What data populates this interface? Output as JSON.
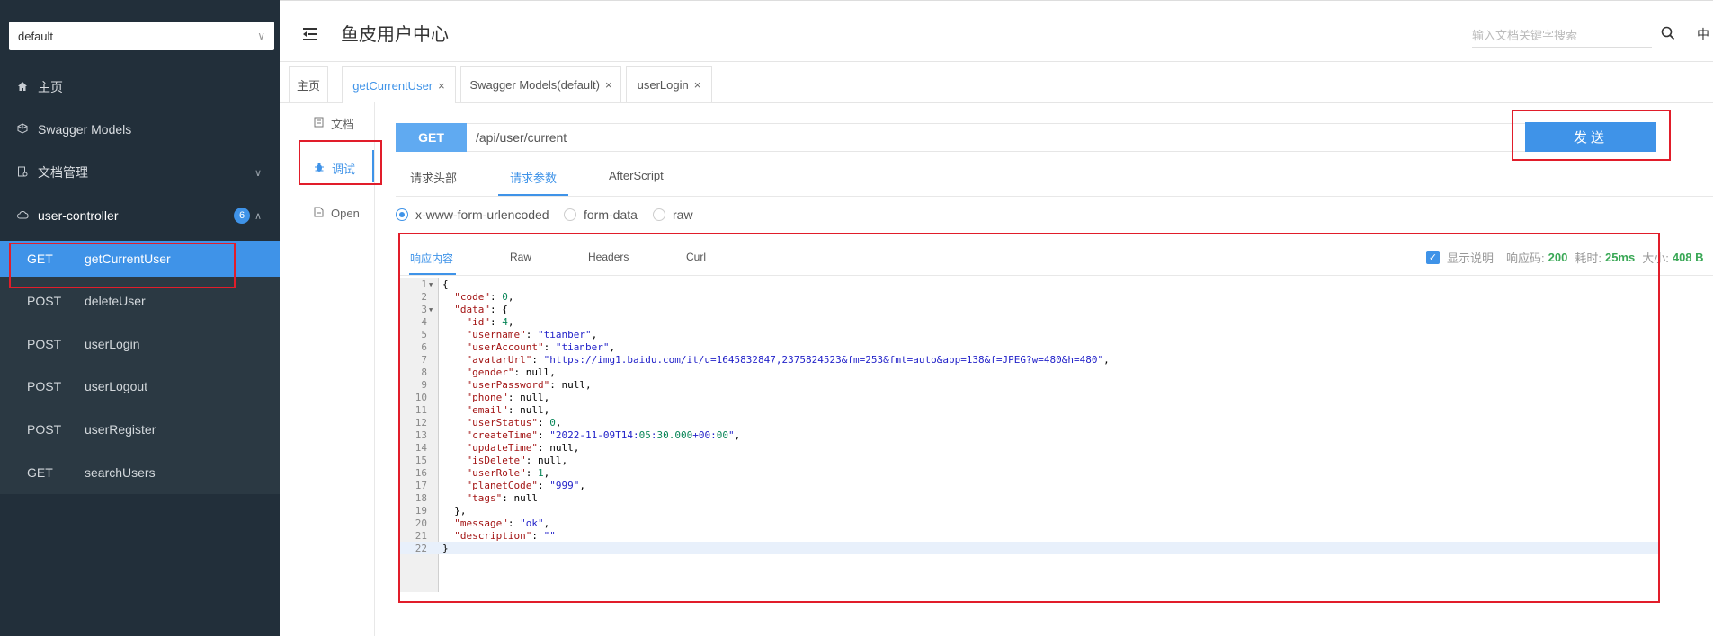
{
  "sidebar": {
    "group_select": "default",
    "nav": [
      {
        "label": "主页",
        "icon": "home-icon"
      },
      {
        "label": "Swagger Models",
        "icon": "cube-icon"
      },
      {
        "label": "文档管理",
        "icon": "document-manage-icon"
      },
      {
        "label": "user-controller",
        "icon": "cloud-icon",
        "badge": "6"
      }
    ],
    "apis": [
      {
        "method": "GET",
        "name": "getCurrentUser",
        "active": true
      },
      {
        "method": "POST",
        "name": "deleteUser"
      },
      {
        "method": "POST",
        "name": "userLogin"
      },
      {
        "method": "POST",
        "name": "userLogout"
      },
      {
        "method": "POST",
        "name": "userRegister"
      },
      {
        "method": "GET",
        "name": "searchUsers"
      }
    ]
  },
  "header": {
    "title": "鱼皮用户中心",
    "search_placeholder": "输入文档关键字搜索",
    "lang": "中"
  },
  "tabs": [
    {
      "label": "主页",
      "closable": false
    },
    {
      "label": "getCurrentUser",
      "closable": true,
      "active": true
    },
    {
      "label": "Swagger Models(default)",
      "closable": true
    },
    {
      "label": "userLogin",
      "closable": true
    }
  ],
  "subnav": [
    {
      "label": "文档",
      "icon": "doc-icon"
    },
    {
      "label": "调试",
      "icon": "bug-icon",
      "active": true
    },
    {
      "label": "Open",
      "icon": "file-icon"
    }
  ],
  "request": {
    "method": "GET",
    "url": "/api/user/current",
    "send_label": "发送",
    "tabs": [
      "请求头部",
      "请求参数",
      "AfterScript"
    ],
    "active_tab": "请求参数",
    "body_types": [
      "x-www-form-urlencoded",
      "form-data",
      "raw"
    ],
    "selected_body_type": "x-www-form-urlencoded"
  },
  "response": {
    "tabs": [
      "响应内容",
      "Raw",
      "Headers",
      "Curl"
    ],
    "active_tab": "响应内容",
    "show_desc_label": "显示说明",
    "show_desc_checked": true,
    "status_label": "响应码:",
    "status": "200",
    "time_label": "耗时:",
    "time": "25ms",
    "size_label": "大小:",
    "size": "408 B",
    "lines": [
      "{",
      "  \"code\": 0,",
      "  \"data\": {",
      "    \"id\": 4,",
      "    \"username\": \"tianber\",",
      "    \"userAccount\": \"tianber\",",
      "    \"avatarUrl\": \"https://img1.baidu.com/it/u=1645832847,2375824523&fm=253&fmt=auto&app=138&f=JPEG?w=480&h=480\",",
      "    \"gender\": null,",
      "    \"userPassword\": null,",
      "    \"phone\": null,",
      "    \"email\": null,",
      "    \"userStatus\": 0,",
      "    \"createTime\": \"2022-11-09T14:05:30.000+00:00\",",
      "    \"updateTime\": null,",
      "    \"isDelete\": null,",
      "    \"userRole\": 1,",
      "    \"planetCode\": \"999\",",
      "    \"tags\": null",
      "  },",
      "  \"message\": \"ok\",",
      "  \"description\": \"\"",
      "}"
    ]
  },
  "colors": {
    "accent": "#3f93e8",
    "sidebar_bg": "#222f3a",
    "annotation": "#e11d2a",
    "success": "#3aa856"
  }
}
